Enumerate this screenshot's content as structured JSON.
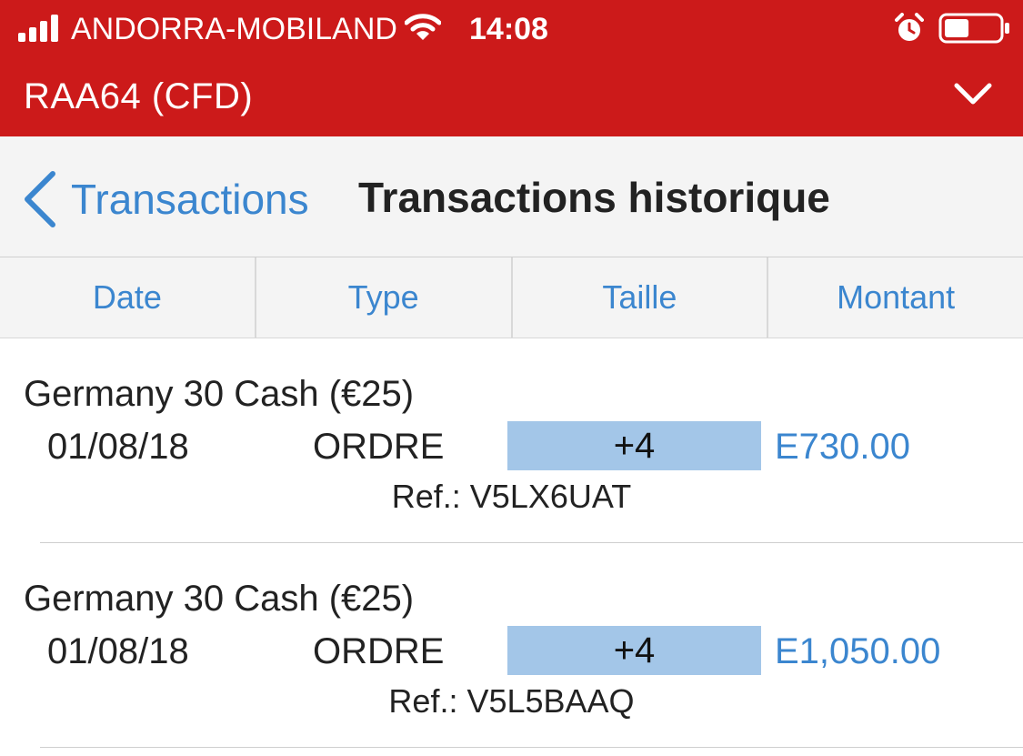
{
  "status_bar": {
    "carrier": "ANDORRA-MOBILAND",
    "time": "14:08",
    "signal_bars": 4,
    "battery_level": 0.45,
    "icons": [
      "signal-icon",
      "wifi-icon",
      "alarm-icon",
      "battery-icon"
    ]
  },
  "header": {
    "account": "RAA64 (CFD)",
    "color": "#cc1a1a",
    "dropdown_icon": "chevron-down-icon"
  },
  "nav": {
    "back_label": "Transactions",
    "title": "Transactions historique",
    "back_icon": "chevron-left-icon"
  },
  "columns": [
    "Date",
    "Type",
    "Taille",
    "Montant"
  ],
  "transactions": [
    {
      "instrument": "Germany 30 Cash (€25)",
      "date": "01/08/18",
      "type": "ORDRE",
      "size": "+4",
      "amount": "E730.00",
      "ref": "Ref.: V5LX6UAT"
    },
    {
      "instrument": "Germany 30 Cash (€25)",
      "date": "01/08/18",
      "type": "ORDRE",
      "size": "+4",
      "amount": "E1,050.00",
      "ref": "Ref.: V5L5BAAQ"
    }
  ],
  "colors": {
    "accent": "#3b86cf",
    "size_highlight": "#a3c6e8"
  }
}
